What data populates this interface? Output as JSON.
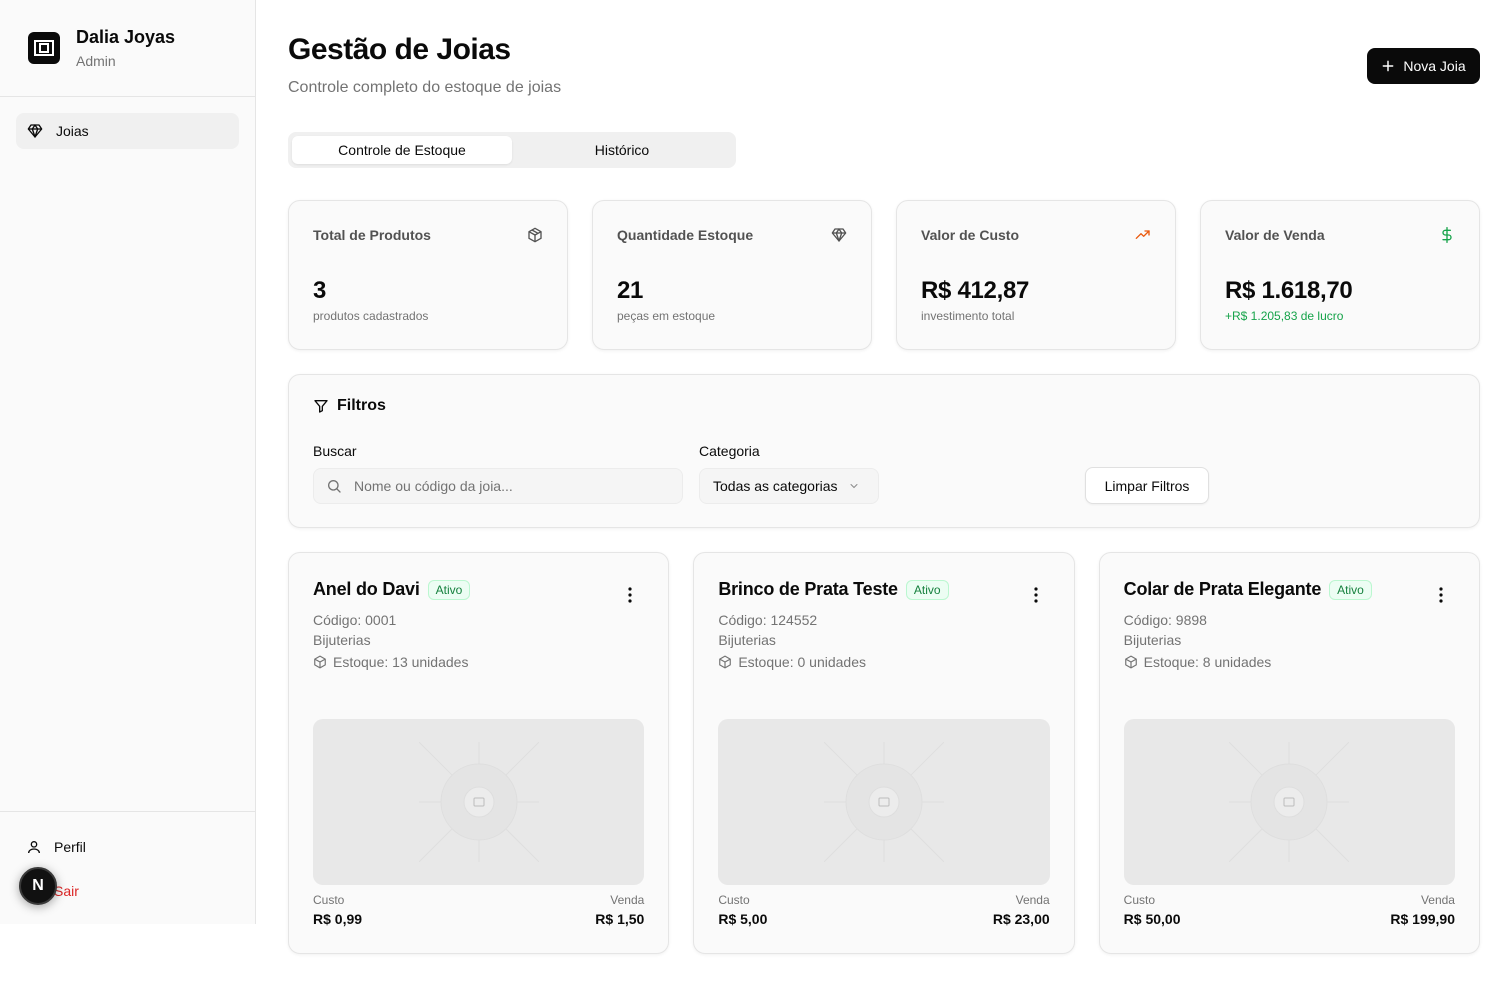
{
  "sidebar": {
    "brand_name": "Dalia Joyas",
    "brand_role": "Admin",
    "nav": [
      {
        "label": "Joias",
        "icon": "gem-icon"
      }
    ],
    "footer": [
      {
        "label": "Perfil",
        "icon": "user-icon"
      },
      {
        "label": "Sair",
        "icon": "logout-icon"
      }
    ],
    "dev_badge": "N"
  },
  "header": {
    "title": "Gestão de Joias",
    "subtitle": "Controle completo do estoque de joias",
    "new_button": "Nova Joia"
  },
  "tabs": [
    {
      "label": "Controle de Estoque",
      "active": true
    },
    {
      "label": "Histórico",
      "active": false
    }
  ],
  "stats": [
    {
      "label": "Total de Produtos",
      "value": "3",
      "note": "produtos cadastrados",
      "icon": "package-icon",
      "icon_color": "#525252"
    },
    {
      "label": "Quantidade Estoque",
      "value": "21",
      "note": "peças em estoque",
      "icon": "gem-icon",
      "icon_color": "#525252"
    },
    {
      "label": "Valor de Custo",
      "value": "R$ 412,87",
      "note": "investimento total",
      "icon": "trending-up-icon",
      "icon_color": "#ea580c"
    },
    {
      "label": "Valor de Venda",
      "value": "R$ 1.618,70",
      "note": "+R$ 1.205,83 de lucro",
      "icon": "dollar-icon",
      "icon_color": "#16a34a"
    }
  ],
  "filters": {
    "title": "Filtros",
    "search_label": "Buscar",
    "search_placeholder": "Nome ou código da joia...",
    "category_label": "Categoria",
    "category_value": "Todas as categorias",
    "clear_button": "Limpar Filtros"
  },
  "products": [
    {
      "name": "Anel do Davi",
      "status": "Ativo",
      "code": "Código: 0001",
      "category": "Bijuterias",
      "stock": "Estoque: 13 unidades",
      "cost_label": "Custo",
      "cost": "R$ 0,99",
      "sale_label": "Venda",
      "sale": "R$ 1,50"
    },
    {
      "name": "Brinco de Prata Teste",
      "status": "Ativo",
      "code": "Código: 124552",
      "category": "Bijuterias",
      "stock": "Estoque: 0 unidades",
      "cost_label": "Custo",
      "cost": "R$ 5,00",
      "sale_label": "Venda",
      "sale": "R$ 23,00"
    },
    {
      "name": "Colar de Prata Elegante",
      "status": "Ativo",
      "code": "Código: 9898",
      "category": "Bijuterias",
      "stock": "Estoque: 8 unidades",
      "cost_label": "Custo",
      "cost": "R$ 50,00",
      "sale_label": "Venda",
      "sale": "R$ 199,90"
    }
  ]
}
